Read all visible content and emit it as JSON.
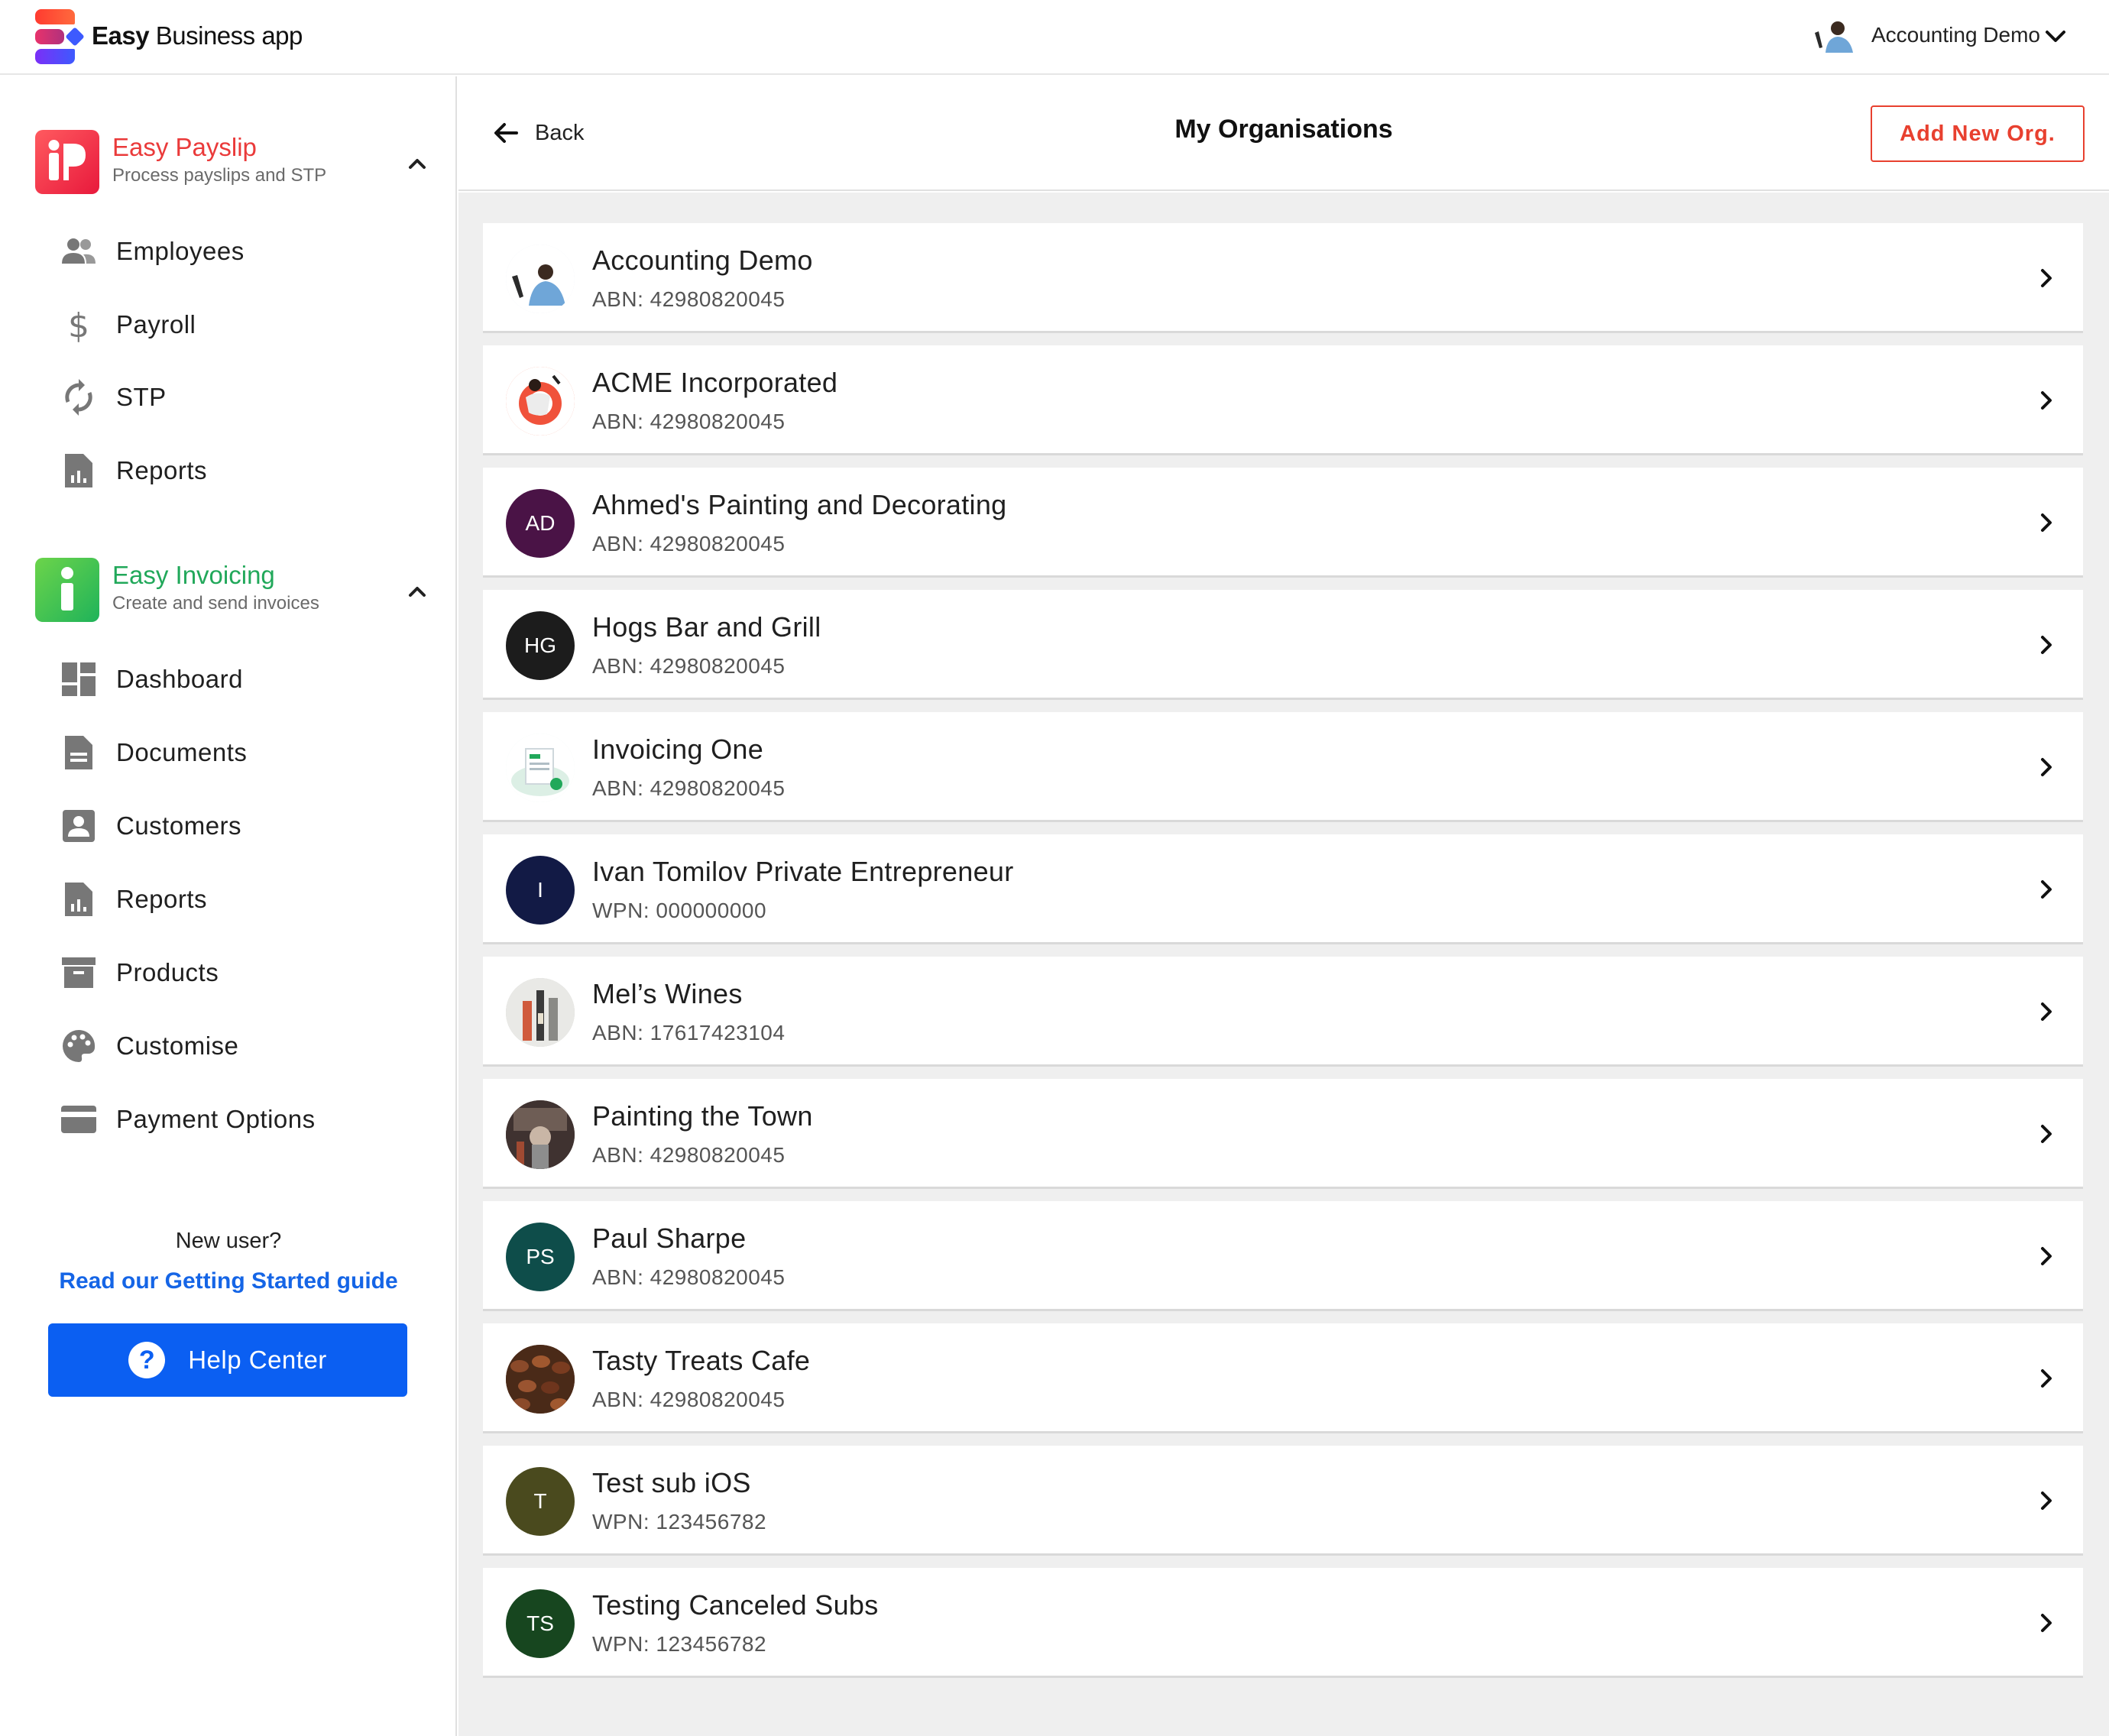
{
  "header": {
    "logo_bold": "Easy",
    "logo_rest": " Business app",
    "account_name": "Accounting Demo"
  },
  "sidebar": {
    "payslip": {
      "title": "Easy Payslip",
      "subtitle": "Process payslips and STP",
      "items": [
        {
          "label": "Employees",
          "icon": "people-icon"
        },
        {
          "label": "Payroll",
          "icon": "dollar-icon"
        },
        {
          "label": "STP",
          "icon": "sync-icon"
        },
        {
          "label": "Reports",
          "icon": "report-icon"
        }
      ]
    },
    "invoicing": {
      "title": "Easy Invoicing",
      "subtitle": "Create and send invoices",
      "items": [
        {
          "label": "Dashboard",
          "icon": "dashboard-icon"
        },
        {
          "label": "Documents",
          "icon": "document-icon"
        },
        {
          "label": "Customers",
          "icon": "contact-icon"
        },
        {
          "label": "Reports",
          "icon": "report-icon"
        },
        {
          "label": "Products",
          "icon": "archive-icon"
        },
        {
          "label": "Customise",
          "icon": "palette-icon"
        },
        {
          "label": "Payment Options",
          "icon": "card-icon"
        }
      ]
    },
    "new_user": "New user?",
    "guide_link": "Read our Getting Started guide",
    "help_button": "Help Center",
    "help_icon_glyph": "?"
  },
  "main": {
    "back_label": "Back",
    "title": "My Organisations",
    "add_button": "Add New Org.",
    "organisations": [
      {
        "name": "Accounting Demo",
        "id": "ABN: 42980820045",
        "avatar_type": "photo",
        "initials": "",
        "color": "#dfe6ee"
      },
      {
        "name": "ACME Incorporated",
        "id": "ABN: 42980820045",
        "avatar_type": "photo",
        "initials": "",
        "color": "#f36b4f"
      },
      {
        "name": "Ahmed's Painting and Decorating",
        "id": "ABN: 42980820045",
        "avatar_type": "initials",
        "initials": "AD",
        "color": "#4a1346"
      },
      {
        "name": "Hogs Bar and Grill",
        "id": "ABN: 42980820045",
        "avatar_type": "initials",
        "initials": "HG",
        "color": "#1c1c1c"
      },
      {
        "name": "Invoicing One",
        "id": "ABN: 42980820045",
        "avatar_type": "photo",
        "initials": "",
        "color": "#e2f4ec"
      },
      {
        "name": "Ivan Tomilov Private Entrepreneur",
        "id": "WPN: 000000000",
        "avatar_type": "initials",
        "initials": "I",
        "color": "#121a45"
      },
      {
        "name": "Mel’s Wines",
        "id": "ABN: 17617423104",
        "avatar_type": "photo",
        "initials": "",
        "color": "#c9c9c4"
      },
      {
        "name": "Painting the Town",
        "id": "ABN: 42980820045",
        "avatar_type": "photo",
        "initials": "",
        "color": "#5a4a44"
      },
      {
        "name": "Paul Sharpe",
        "id": "ABN: 42980820045",
        "avatar_type": "initials",
        "initials": "PS",
        "color": "#0e4d4a"
      },
      {
        "name": "Tasty Treats Cafe",
        "id": "ABN: 42980820045",
        "avatar_type": "photo",
        "initials": "",
        "color": "#6b3a22"
      },
      {
        "name": "Test sub iOS",
        "id": "WPN: 123456782",
        "avatar_type": "initials",
        "initials": "T",
        "color": "#4a4a1e"
      },
      {
        "name": "Testing Canceled Subs",
        "id": "WPN: 123456782",
        "avatar_type": "initials",
        "initials": "TS",
        "color": "#17461f"
      }
    ]
  },
  "colors": {
    "accent_red": "#e8402f",
    "link_blue": "#1565e6",
    "help_blue": "#0b5ff2",
    "payslip_red": "#ea3a3a",
    "invoicing_green": "#21a85a"
  }
}
